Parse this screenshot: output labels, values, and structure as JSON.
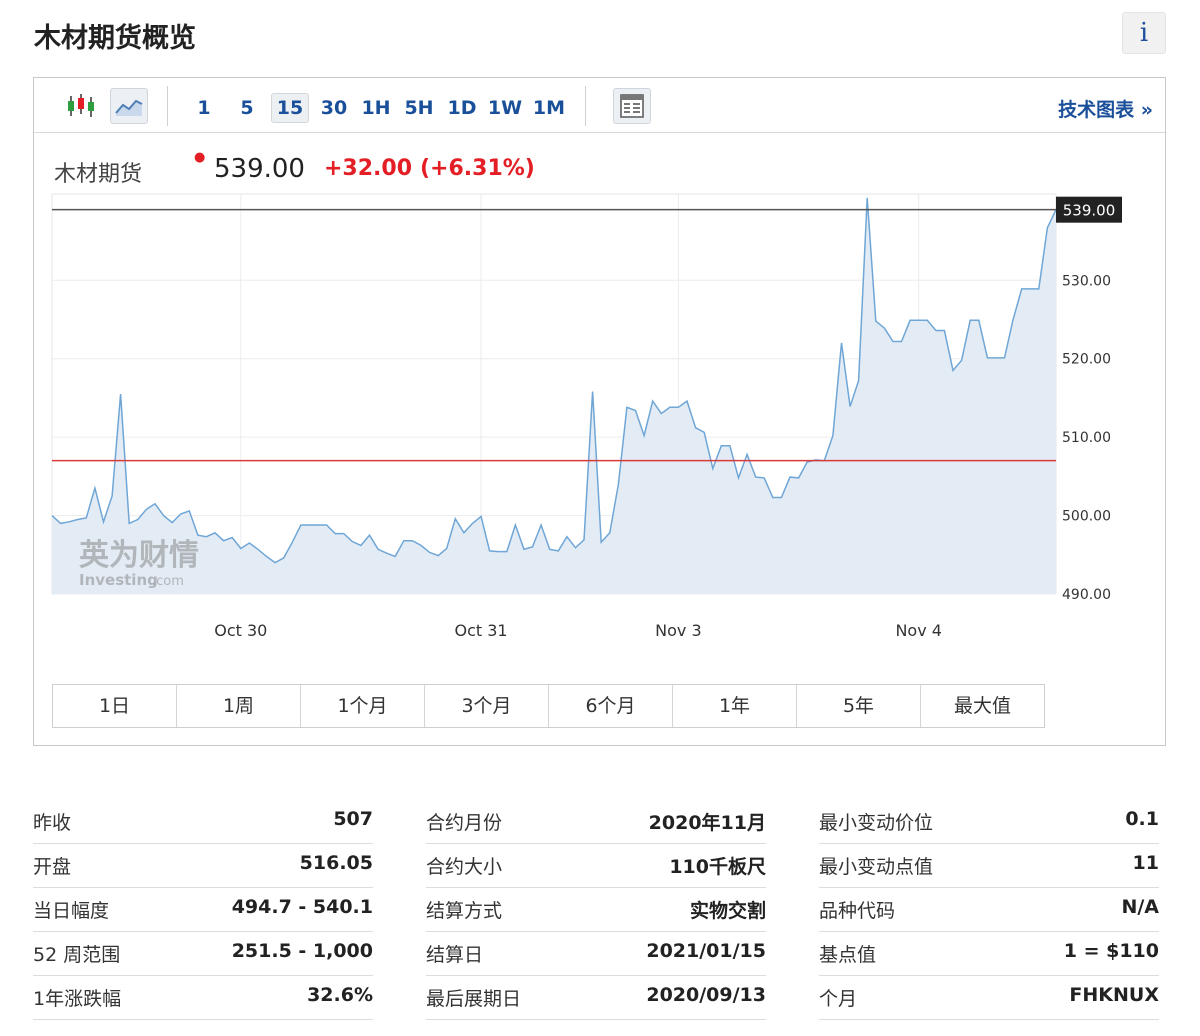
{
  "header": {
    "title": "木材期货概览",
    "info_label": "i"
  },
  "toolbar": {
    "chart_type_icons": [
      "candlestick-icon",
      "line-chart-icon"
    ],
    "intervals": [
      "1",
      "5",
      "15",
      "30",
      "1H",
      "5H",
      "1D",
      "1W",
      "1M"
    ],
    "active_interval": "15",
    "table_icon": "table-icon",
    "tech_chart_link": "技术图表 »"
  },
  "quote": {
    "name": "木材期货",
    "price": "539.00",
    "change": "+32.00",
    "change_pct": "(+6.31%)",
    "up_color": "#e31e24"
  },
  "chart_data": {
    "type": "area",
    "last_price_label": "539.00",
    "last_price": 539.0,
    "prev_close": 507.0,
    "ylim": [
      490,
      541
    ],
    "yticks": [
      "490.00",
      "500.00",
      "510.00",
      "520.00",
      "530.00"
    ],
    "ytick_values": [
      490,
      500,
      510,
      520,
      530
    ],
    "xtick_labels": [
      "Oct 30",
      "Oct 31",
      "Nov 3",
      "Nov 4"
    ],
    "xtick_index": [
      22,
      50,
      73,
      101
    ],
    "line_color": "#6fa6d6",
    "fill_color": "#e3ecf5",
    "prev_close_color": "#d93a3a",
    "values": [
      500,
      499,
      499.2,
      499.5,
      499.7,
      503.5,
      499.2,
      502.5,
      515.5,
      499,
      499.5,
      500.8,
      501.5,
      500,
      499.1,
      500.2,
      500.6,
      497.5,
      497.3,
      497.8,
      496.8,
      497.2,
      495.8,
      496.5,
      495.7,
      494.8,
      494,
      494.6,
      496.6,
      498.8,
      498.8,
      498.8,
      498.8,
      497.7,
      497.7,
      496.7,
      496.2,
      497.5,
      495.7,
      495.2,
      494.8,
      496.8,
      496.8,
      496.2,
      495.3,
      494.9,
      495.8,
      499.6,
      497.8,
      499,
      499.9,
      495.5,
      495.4,
      495.4,
      498.8,
      495.7,
      496,
      498.8,
      495.7,
      495.5,
      497.3,
      495.9,
      496.9,
      515.8,
      496.6,
      497.8,
      504,
      513.8,
      513.4,
      510.2,
      514.6,
      513,
      513.8,
      513.8,
      514.6,
      511.2,
      510.6,
      506,
      508.9,
      508.9,
      504.8,
      507.8,
      504.9,
      504.8,
      502.3,
      502.3,
      504.9,
      504.8,
      506.8,
      507.1,
      507,
      510.2,
      522,
      513.9,
      517.2,
      540.5,
      524.8,
      523.9,
      522.2,
      522.2,
      524.9,
      524.9,
      524.9,
      523.6,
      523.6,
      518.5,
      519.8,
      524.9,
      524.9,
      520.1,
      520.1,
      520.1,
      525,
      528.9,
      528.9,
      528.9,
      536.7,
      539
    ]
  },
  "watermark": {
    "brand_cn": "英为财情",
    "brand_en": "Investing",
    "brand_suffix": ".com"
  },
  "ranges": [
    "1日",
    "1周",
    "1个月",
    "3个月",
    "6个月",
    "1年",
    "5年",
    "最大值"
  ],
  "stats": {
    "col1": [
      {
        "label": "昨收",
        "value": "507"
      },
      {
        "label": "开盘",
        "value": "516.05"
      },
      {
        "label": "当日幅度",
        "value": "494.7 - 540.1"
      },
      {
        "label": "52 周范围",
        "value": "251.5 - 1,000"
      },
      {
        "label": "1年涨跌幅",
        "value": "32.6%"
      }
    ],
    "col2": [
      {
        "label": "合约月份",
        "value": "2020年11月"
      },
      {
        "label": "合约大小",
        "value": "110千板尺"
      },
      {
        "label": "结算方式",
        "value": "实物交割"
      },
      {
        "label": "结算日",
        "value": "2021/01/15"
      },
      {
        "label": "最后展期日",
        "value": "2020/09/13"
      }
    ],
    "col3": [
      {
        "label": "最小变动价位",
        "value": "0.1"
      },
      {
        "label": "最小变动点值",
        "value": "11"
      },
      {
        "label": "品种代码",
        "value": "N/A"
      },
      {
        "label": "基点值",
        "value": "1 = $110"
      },
      {
        "label": "个月",
        "value": "FHKNUX"
      }
    ]
  }
}
